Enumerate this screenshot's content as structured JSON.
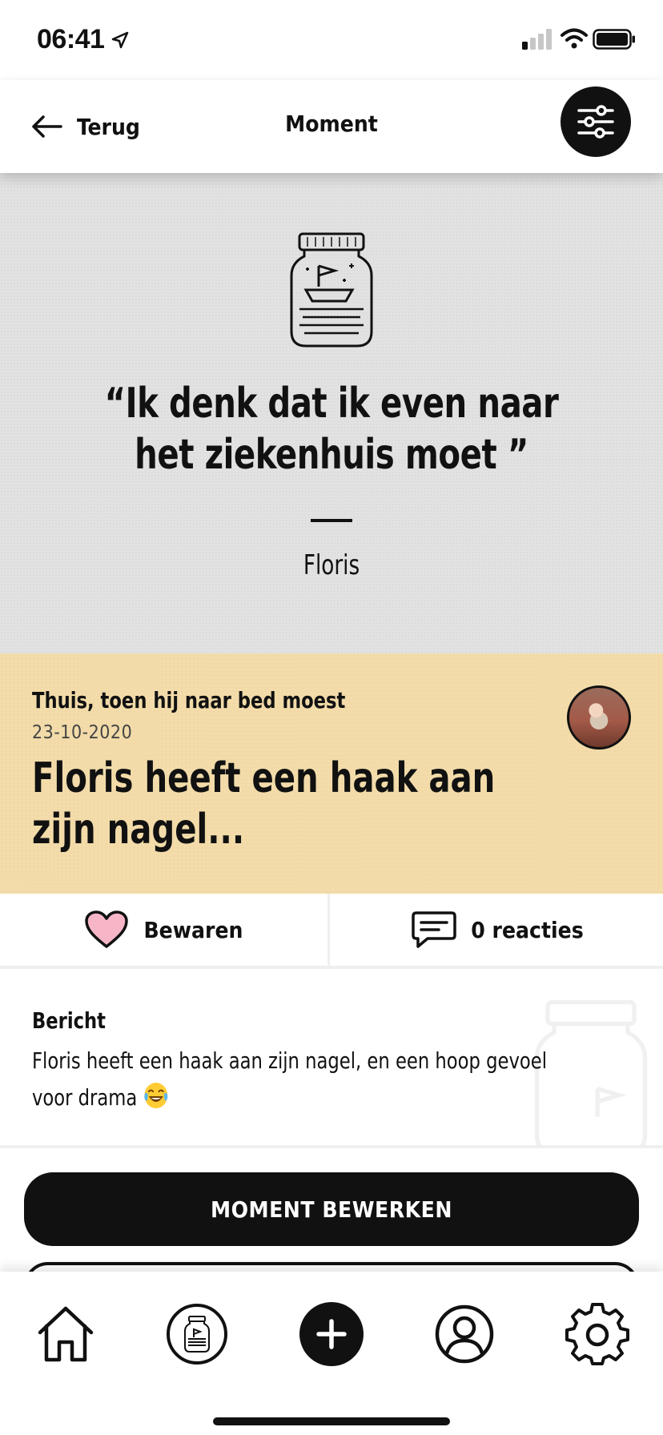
{
  "status_bar": {
    "time": "06:41"
  },
  "nav": {
    "back_label": "Terug",
    "title": "Moment"
  },
  "quote": {
    "text": "“Ik denk dat ik even naar het ziekenhuis moet ”",
    "author": "Floris"
  },
  "moment": {
    "location": "Thuis, toen hij naar bed moest",
    "date": "23-10-2020",
    "title": "Floris heeft een haak aan zijn nagel..."
  },
  "actions": {
    "save_label": "Bewaren",
    "comments_label": "0 reacties"
  },
  "message": {
    "label": "Bericht",
    "body": "Floris heeft een haak aan zijn nagel, en een hoop gevoel voor drama"
  },
  "buttons": {
    "edit_label": "MOMENT BEWERKEN"
  },
  "colors": {
    "hero_bg": "#e2e2e2",
    "info_bg": "#f3dcaa",
    "heart": "#f7b6c8",
    "dark": "#111111"
  },
  "icons": {
    "tabs": [
      "home-icon",
      "jar-icon",
      "plus-icon",
      "profile-icon",
      "gear-icon"
    ]
  }
}
